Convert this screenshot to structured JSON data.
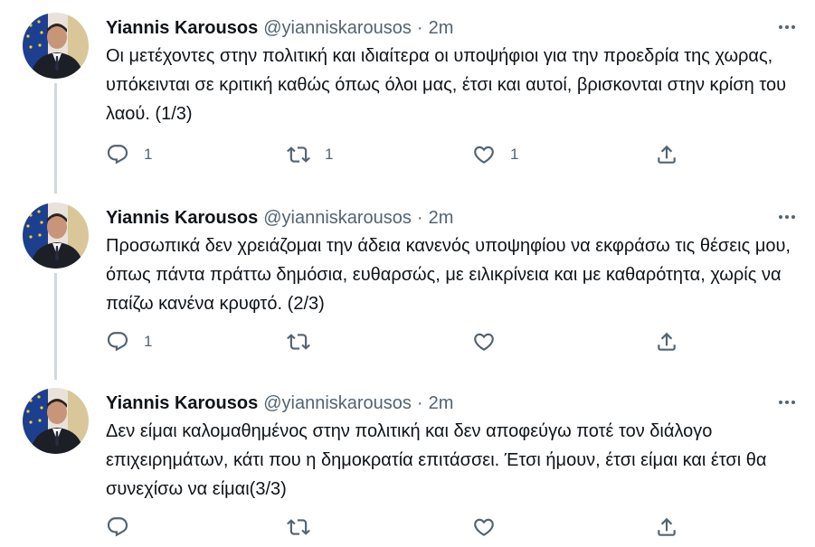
{
  "tweets": [
    {
      "name": "Yiannis Karousos",
      "handle": "@yianniskarousos",
      "separator": "·",
      "time": "2m",
      "text": "Οι μετέχοντες στην πολιτική και ιδιαίτερα οι υποψήφιοι για την προεδρία της χωρας, υπόκεινται σε κριτική καθώς όπως όλοι μας, έτσι και αυτοί, βρισκονται στην κρίση του λαού. (1/3)",
      "reply_count": "1",
      "retweet_count": "1",
      "like_count": "1"
    },
    {
      "name": "Yiannis Karousos",
      "handle": "@yianniskarousos",
      "separator": "·",
      "time": "2m",
      "text": "Προσωπικά δεν χρειάζομαι την άδεια κανενός υποψηφίου να εκφράσω τις θέσεις μου, όπως πάντα πράττω δημόσια, ευθαρσώς, με ειλικρίνεια και με καθαρότητα, χωρίς να παίζω κανένα κρυφτό. (2/3)",
      "reply_count": "1",
      "retweet_count": "",
      "like_count": ""
    },
    {
      "name": "Yiannis Karousos",
      "handle": "@yianniskarousos",
      "separator": "·",
      "time": "2m",
      "text": "Δεν είμαι καλομαθημένος στην πολιτική και δεν αποφεύγω ποτέ τον διάλογο επιχειρημάτων, κάτι που η δημοκρατία επιτάσσει. Έτσι ήμουν, έτσι είμαι και έτσι θα συνεχίσω να είμαι(3/3)",
      "reply_count": "",
      "retweet_count": "",
      "like_count": ""
    }
  ],
  "icons": {
    "reply": "reply-icon",
    "retweet": "retweet-icon",
    "like": "like-icon",
    "share": "share-icon",
    "more": "more-icon"
  },
  "colors": {
    "text": "#0f1419",
    "secondary": "#536471",
    "thread_line": "#cfd9de"
  }
}
